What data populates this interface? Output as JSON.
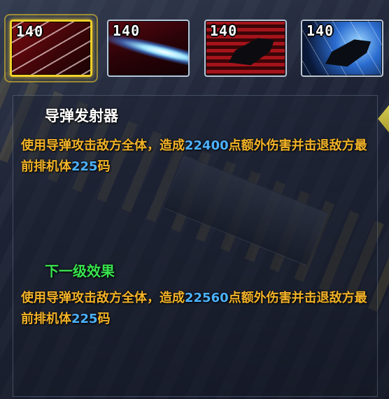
{
  "skills": [
    {
      "level": "140",
      "name": "导弹发射器",
      "image": "missile-barrage"
    },
    {
      "level": "140",
      "name": "",
      "image": "laser-beam"
    },
    {
      "level": "140",
      "name": "",
      "image": "dark-fighter-red"
    },
    {
      "level": "140",
      "name": "",
      "image": "dark-fighter-blue"
    }
  ],
  "selected_index": 0,
  "detail": {
    "title": "导弹发射器",
    "current": {
      "text_before": "使用导弹攻击敌方全体，造成",
      "damage": "22400",
      "text_mid": "点额外伤害并击退敌方最前排机体",
      "knockback": "225",
      "text_after": "码"
    },
    "next_label": "下一级效果",
    "next": {
      "text_before": "使用导弹攻击敌方全体，造成",
      "damage": "22560",
      "text_mid": "点额外伤害并击退敌方最前排机体",
      "knockback": "225",
      "text_after": "码"
    }
  },
  "colors": {
    "title": "#ffffff",
    "description": "#f3b329",
    "number": "#4cb2ff",
    "next_label": "#39e34f",
    "selected_frame": "#f2d02a"
  }
}
